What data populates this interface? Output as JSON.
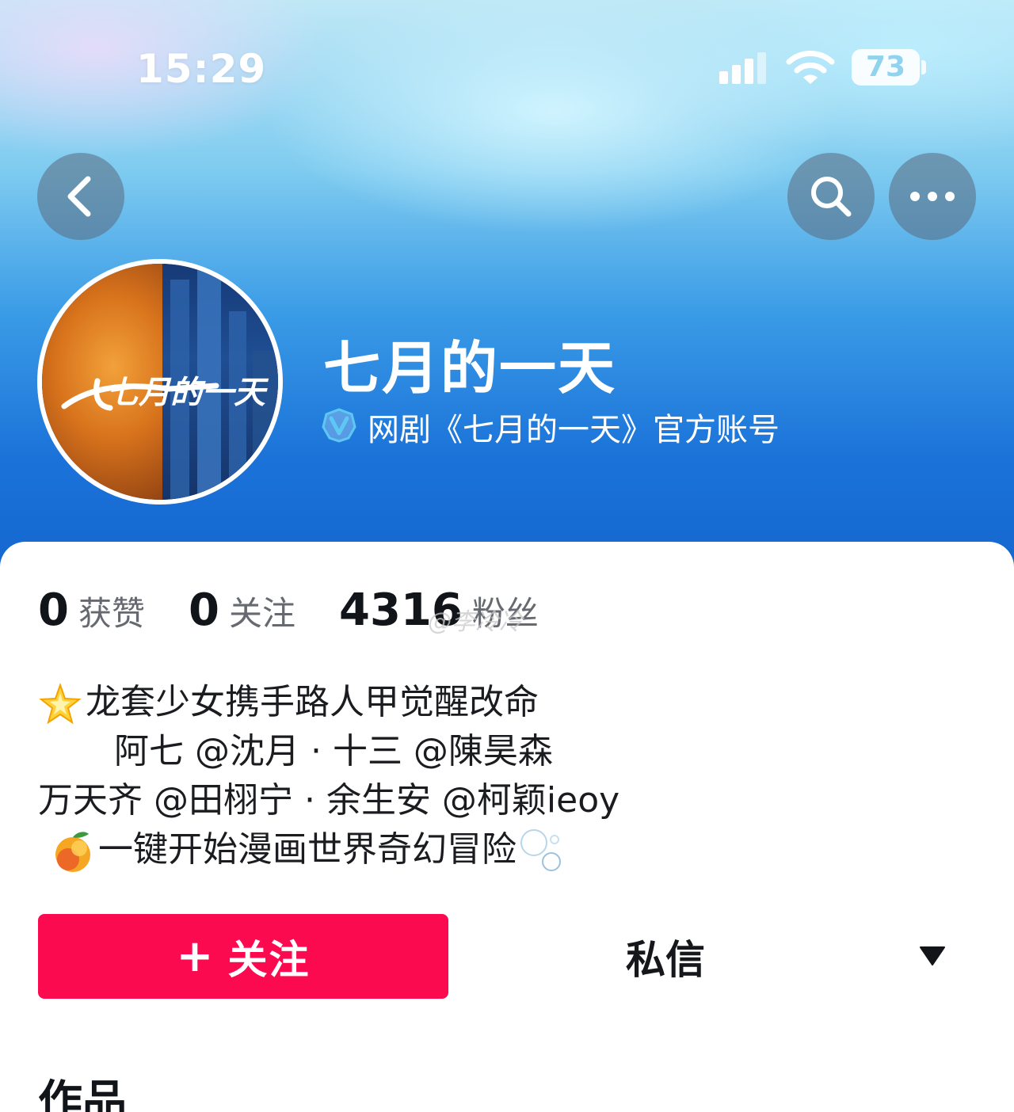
{
  "status_bar": {
    "time": "15:29",
    "battery": "73"
  },
  "nav": {
    "back_icon": "chevron-left-icon",
    "search_icon": "search-icon",
    "more_icon": "more-horizontal-icon"
  },
  "profile": {
    "name": "七月的一天",
    "verified_text": "网剧《七月的一天》官方账号",
    "avatar_logo_text": "七月的一天"
  },
  "stats": [
    {
      "value": "0",
      "label": "获赞"
    },
    {
      "value": "0",
      "label": "关注"
    },
    {
      "value": "4316",
      "label": "粉丝"
    }
  ],
  "watermark": "@李冷冷",
  "bio": {
    "line1": "龙套少女携手路人甲觉醒改命",
    "line2": "阿七 @沈月 · 十三 @陳昊森",
    "line3": "万天齐 @田栩宁 · 余生安 @柯颖ieoy",
    "line4": "一键开始漫画世界奇幻冒险"
  },
  "actions": {
    "follow_plus": "+",
    "follow_label": "关注",
    "message_label": "私信"
  },
  "section": {
    "works_title": "作品"
  },
  "colors": {
    "follow_button": "#fc0a4f",
    "header_top": "#bfe8f6",
    "header_bottom": "#1467cf",
    "verified_icon": "#5ec8f5"
  }
}
